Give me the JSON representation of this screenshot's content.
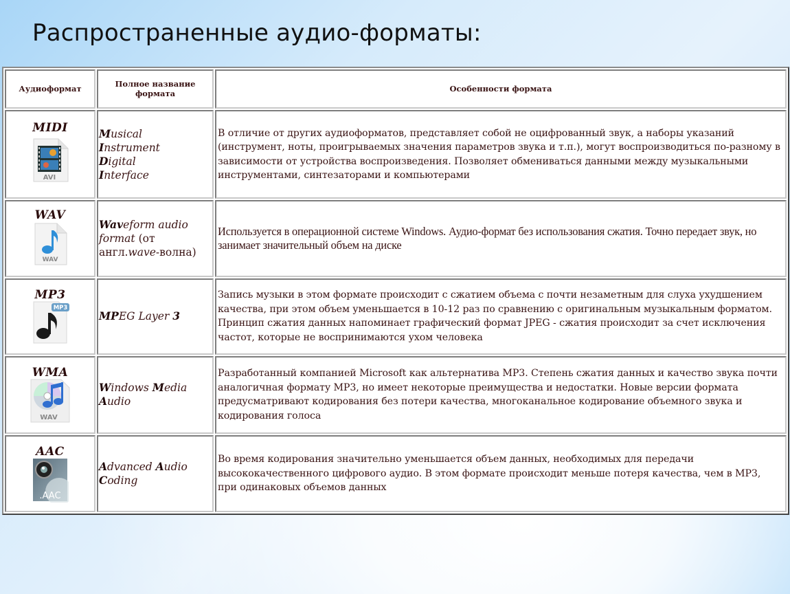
{
  "title": "Распространенные аудио-форматы:",
  "table": {
    "headers": {
      "format": "Аудиоформат",
      "full_name": "Полное название формата",
      "features": "Особенности формата"
    },
    "rows": [
      {
        "format": "MIDI",
        "icon": "avi-file-icon",
        "icon_label": "AVI",
        "full_name_parts": [
          {
            "initial": "M",
            "rest": "usical"
          },
          {
            "initial": "I",
            "rest": "nstrument"
          },
          {
            "initial": "D",
            "rest": "igital"
          },
          {
            "initial": "I",
            "rest": "nterface"
          }
        ],
        "description": "В отличие от других аудиоформатов, представляет собой не оцифрованный звук, а наборы указаний (инструмент, ноты, проигрываемых значения параметров звука и т.п.), могут воспроизводиться по-разному в зависимости от устройства воспроизведения. Позволяет обмениваться данными между музыкальными инструментами, синтезаторами и компьютерами"
      },
      {
        "format": "WAV",
        "icon": "wav-file-icon",
        "icon_label": "WAV",
        "full_name_bold": "Wav",
        "full_name_italic": "eform audio format",
        "full_name_suffix": " (от англ.",
        "full_name_italic2": "wave",
        "full_name_suffix2": "-волна)",
        "description": "Используется в операционной системе Windows. Аудио-формат без использования сжатия. Точно передает звук, но занимает значительный объем на диске"
      },
      {
        "format": "MP3",
        "icon": "mp3-file-icon",
        "icon_label": "MP3",
        "full_name_bold": "MP",
        "full_name_italic": "EG Layer ",
        "full_name_bold2": "3",
        "description": "Запись музыки в этом формате происходит с сжатием объема с почти незаметным для слуха ухудшением качества, при этом объем уменьшается в 10-12 раз по сравнению с оригинальным музыкальным форматом. Принцип сжатия данных напоминает графический формат JPEG - сжатия происходит за счет исключения частот, которые не воспринимаются ухом человека"
      },
      {
        "format": "WMA",
        "icon": "wma-file-icon",
        "icon_label": "WAV",
        "full_name_parts": [
          {
            "initial": "W",
            "rest": "indows "
          },
          {
            "initial": "M",
            "rest": "edia"
          },
          {
            "initial": "A",
            "rest": "udio"
          }
        ],
        "description": "Разработанный компанией Microsoft как альтернатива MP3. Степень сжатия данных и качество звука почти аналогичная формату MP3, но имеет некоторые преимущества и недостатки. Новые версии формата предусматривают кодирования без потери качества, многоканальное кодирование объемного звука и кодирования голоса"
      },
      {
        "format": "AAC",
        "icon": "aac-file-icon",
        "icon_label": ".AAC",
        "full_name_parts": [
          {
            "initial": "A",
            "rest": "dvanced "
          },
          {
            "initial": "A",
            "rest": "udio"
          },
          {
            "initial": "C",
            "rest": "oding"
          }
        ],
        "description": "Во время кодирования значительно уменьшается объем данных, необходимых для передачи высококачественного цифрового аудио. В этом формате происходит меньше потеря качества, чем в MP3, при одинаковых объемов данных"
      }
    ]
  },
  "colors": {
    "text": "#3b1313",
    "title": "#111111",
    "border": "#9a9a9a",
    "background_edge": "#a6d5f8",
    "background_center": "#ffffff"
  }
}
